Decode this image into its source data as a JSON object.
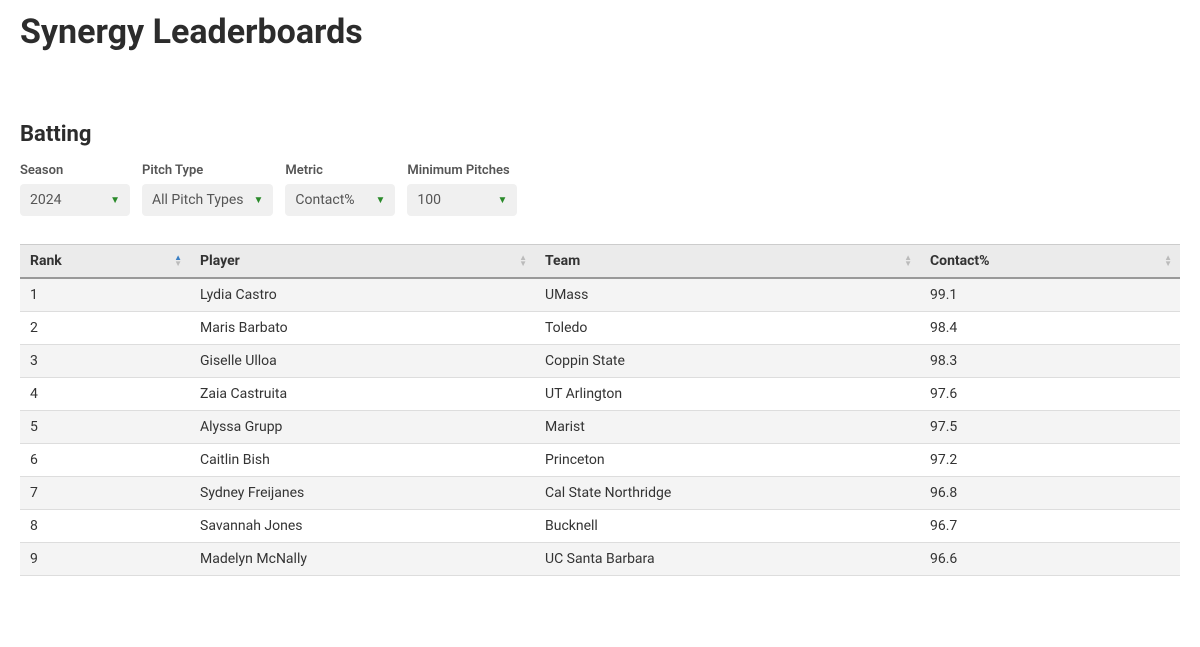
{
  "page_title": "Synergy Leaderboards",
  "section_title": "Batting",
  "filters": {
    "season": {
      "label": "Season",
      "value": "2024"
    },
    "pitch": {
      "label": "Pitch Type",
      "value": "All Pitch Types"
    },
    "metric": {
      "label": "Metric",
      "value": "Contact%"
    },
    "minpitch": {
      "label": "Minimum Pitches",
      "value": "100"
    }
  },
  "columns": {
    "rank": "Rank",
    "player": "Player",
    "team": "Team",
    "metric": "Contact%"
  },
  "rows": [
    {
      "rank": "1",
      "player": "Lydia Castro",
      "team": "UMass",
      "metric": "99.1"
    },
    {
      "rank": "2",
      "player": "Maris Barbato",
      "team": "Toledo",
      "metric": "98.4"
    },
    {
      "rank": "3",
      "player": "Giselle Ulloa",
      "team": "Coppin State",
      "metric": "98.3"
    },
    {
      "rank": "4",
      "player": "Zaia Castruita",
      "team": "UT Arlington",
      "metric": "97.6"
    },
    {
      "rank": "5",
      "player": "Alyssa Grupp",
      "team": "Marist",
      "metric": "97.5"
    },
    {
      "rank": "6",
      "player": "Caitlin Bish",
      "team": "Princeton",
      "metric": "97.2"
    },
    {
      "rank": "7",
      "player": "Sydney Freijanes",
      "team": "Cal State Northridge",
      "metric": "96.8"
    },
    {
      "rank": "8",
      "player": "Savannah Jones",
      "team": "Bucknell",
      "metric": "96.7"
    },
    {
      "rank": "9",
      "player": "Madelyn McNally",
      "team": "UC Santa Barbara",
      "metric": "96.6"
    }
  ]
}
